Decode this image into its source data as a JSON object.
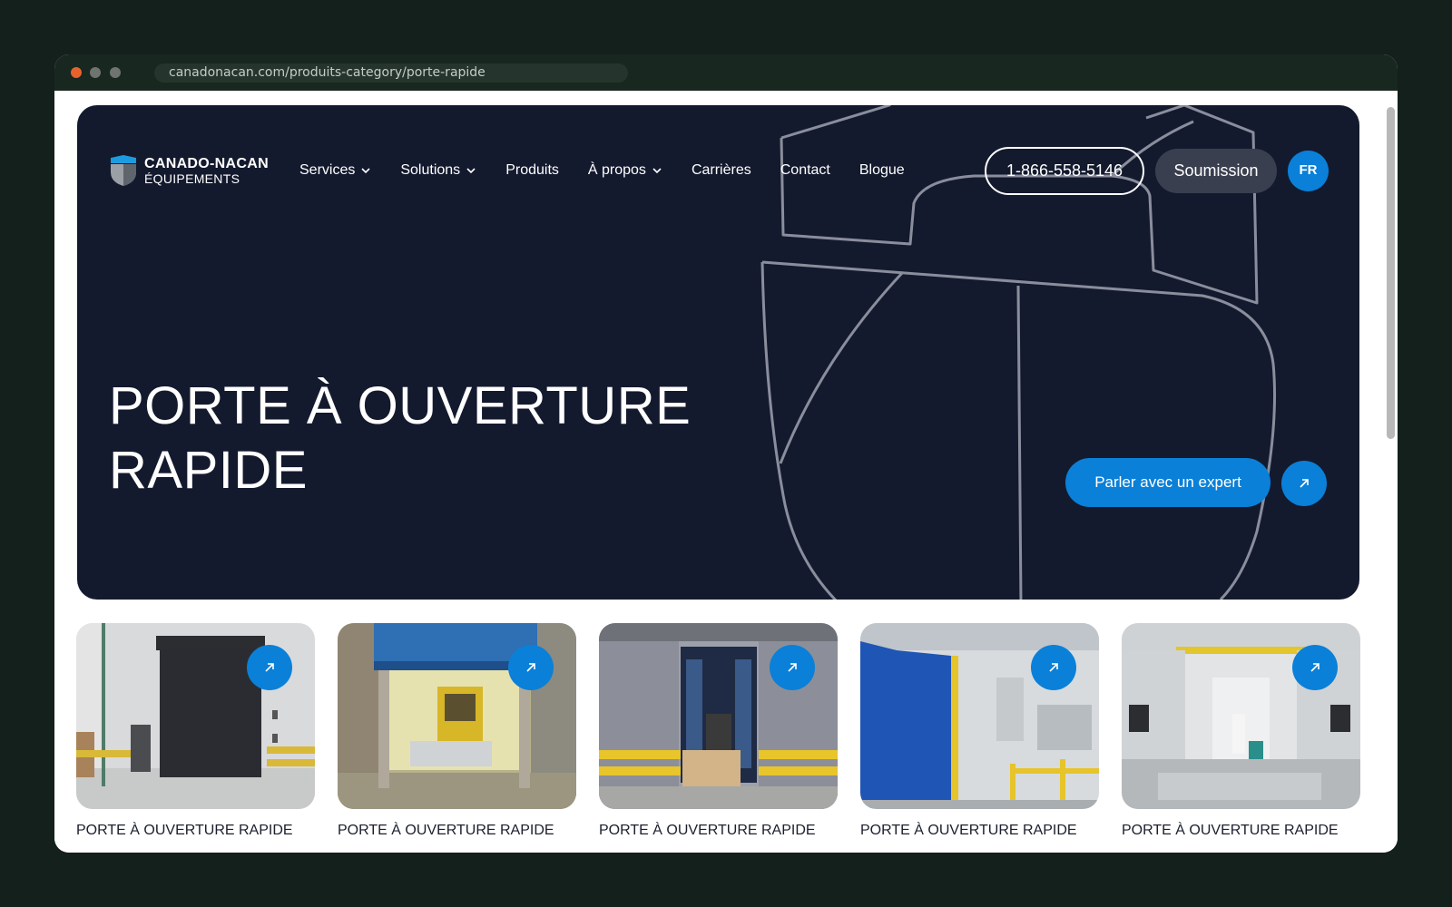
{
  "browser": {
    "url": "canadonacan.com/produits-category/porte-rapide"
  },
  "header": {
    "logo_name": "CANADO-NACAN",
    "logo_sub": "ÉQUIPEMENTS",
    "nav": [
      {
        "label": "Services",
        "dropdown": true
      },
      {
        "label": "Solutions",
        "dropdown": true
      },
      {
        "label": "Produits",
        "dropdown": false
      },
      {
        "label": "À propos",
        "dropdown": true
      },
      {
        "label": "Carrières",
        "dropdown": false
      },
      {
        "label": "Contact",
        "dropdown": false
      },
      {
        "label": "Blogue",
        "dropdown": false
      }
    ],
    "phone": "1-866-558-5146",
    "quote_label": "Soumission",
    "lang_label": "FR"
  },
  "hero": {
    "title_line1": "PORTE À OUVERTURE",
    "title_line2": "RAPIDE",
    "cta_label": "Parler avec un expert",
    "cta_icon": "arrow-up-right-icon"
  },
  "products": [
    {
      "category": "PORTE À OUVERTURE RAPIDE",
      "image": "black-roll-door-warehouse"
    },
    {
      "category": "PORTE À OUVERTURE RAPIDE",
      "image": "blue-curtain-forklift-door"
    },
    {
      "category": "PORTE À OUVERTURE RAPIDE",
      "image": "sliding-door-forklift-boxes"
    },
    {
      "category": "PORTE À OUVERTURE RAPIDE",
      "image": "blue-panel-door-loading"
    },
    {
      "category": "PORTE À OUVERTURE RAPIDE",
      "image": "white-corridor-cleaning"
    }
  ],
  "colors": {
    "page_bg": "#14201c",
    "hero_bg": "#141a2e",
    "accent": "#0a80d8",
    "quote_bg": "#3a3f50"
  }
}
